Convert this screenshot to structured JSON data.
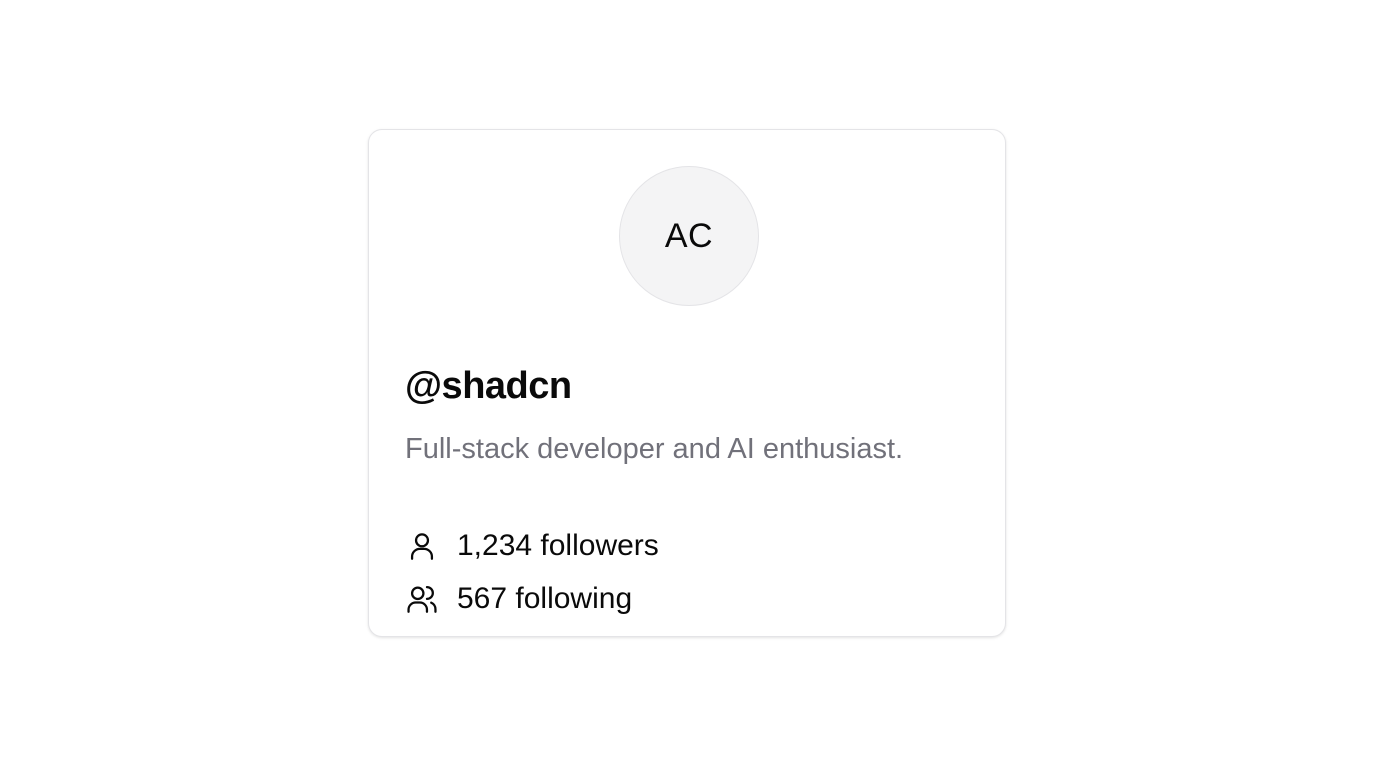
{
  "profile": {
    "avatar_initials": "AC",
    "username": "@shadcn",
    "bio": "Full-stack developer and AI enthusiast."
  },
  "stats": {
    "followers_label": "1,234 followers",
    "followers_icon": "user-icon",
    "following_label": "567 following",
    "following_icon": "users-icon"
  },
  "colors": {
    "text": "#0a0a0a",
    "muted_text": "#71717a",
    "avatar_bg": "#f4f4f5",
    "border": "#e4e4e7"
  }
}
